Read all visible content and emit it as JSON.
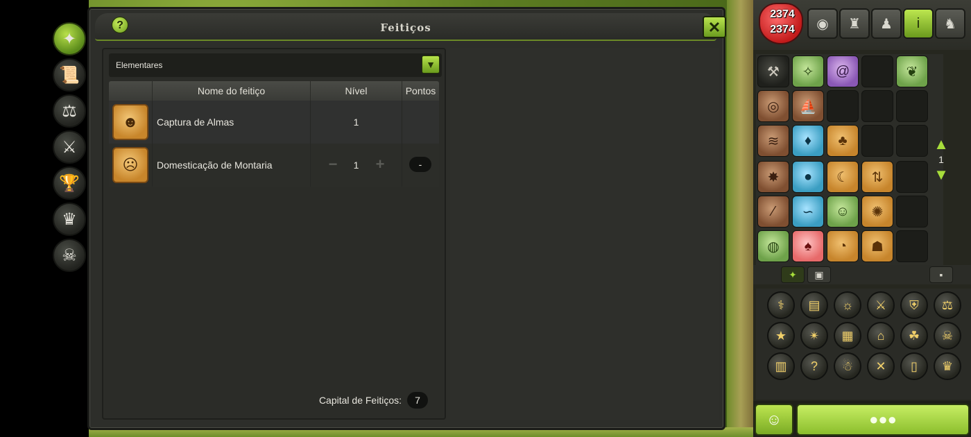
{
  "window": {
    "title": "Feitiços",
    "help_glyph": "?",
    "close_glyph": "✕"
  },
  "filter": {
    "selected": "Elementares",
    "arrow_glyph": "▼"
  },
  "table": {
    "headers": {
      "name": "Nome do feitiço",
      "level": "Nível",
      "points": "Pontos"
    },
    "rows": [
      {
        "icon": "skull-spell-icon",
        "name": "Captura de Almas",
        "level": "1"
      },
      {
        "icon": "mount-taming-spell-icon",
        "name": "Domesticação de Montaria",
        "level": "1",
        "points": "-",
        "minus": "−",
        "plus": "+"
      }
    ]
  },
  "capital": {
    "label": "Capital de Feitiços:",
    "value": "7"
  },
  "hud": {
    "hp_current": "2374",
    "hp_max": "2374",
    "page": "1",
    "arrow_up": "▲",
    "arrow_down": "▼"
  },
  "colors": {
    "accent_green": "#a7dd3b",
    "panel_bg": "#2b2c28",
    "heart_red": "#c21b1b"
  }
}
